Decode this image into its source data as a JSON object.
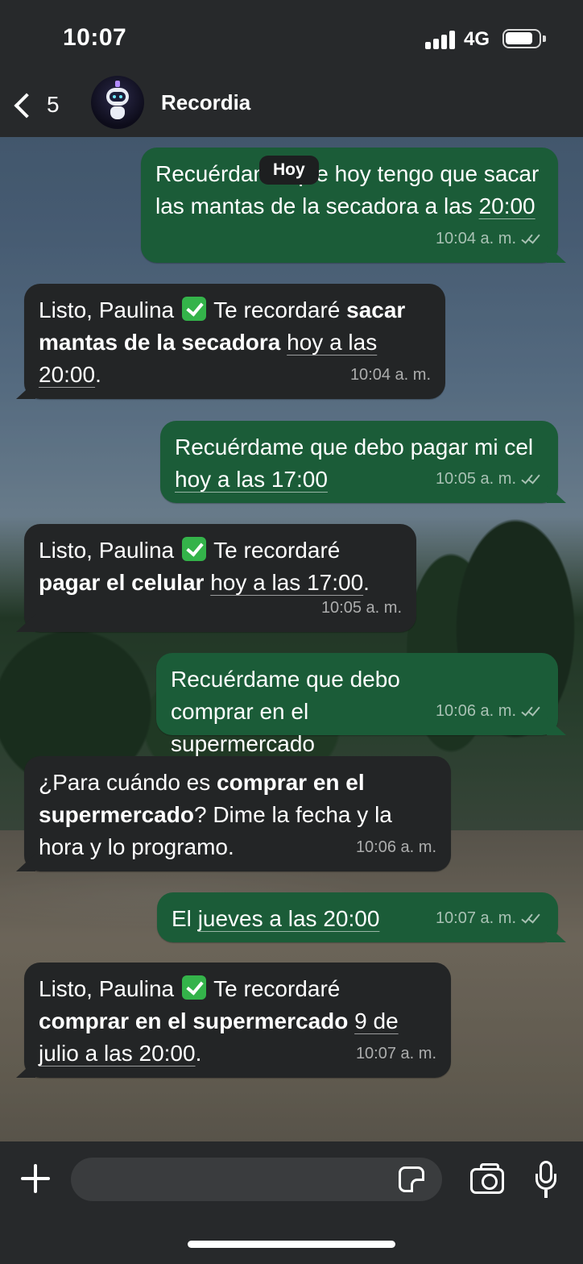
{
  "status_bar": {
    "time": "10:07",
    "network": "4G"
  },
  "header": {
    "back_count": "5",
    "contact_name": "Recordia"
  },
  "date_chip": "Hoy",
  "messages": [
    {
      "direction": "outgoing",
      "parts": [
        "Recuérdame que hoy tengo que sacar las mantas de la secadora a las ",
        "20:00"
      ],
      "time": "10:04 a. m."
    },
    {
      "direction": "incoming",
      "parts": [
        "Listo, Paulina ",
        " Te recordaré ",
        "sacar mantas de la secadora",
        " ",
        "hoy a las 20:00",
        "."
      ],
      "time": "10:04 a. m."
    },
    {
      "direction": "outgoing",
      "parts": [
        "Recuérdame que debo pagar mi cel ",
        "hoy a las 17:00"
      ],
      "time": "10:05 a. m."
    },
    {
      "direction": "incoming",
      "parts": [
        "Listo, Paulina ",
        " Te recordaré ",
        "pagar el celular",
        " ",
        "hoy a las 17:00",
        "."
      ],
      "time": "10:05 a. m."
    },
    {
      "direction": "outgoing",
      "parts": [
        "Recuérdame que debo comprar en el supermercado"
      ],
      "time": "10:06 a. m."
    },
    {
      "direction": "incoming",
      "parts": [
        "¿Para cuándo es ",
        "comprar en el supermercado",
        "? Dime la fecha y la hora y lo programo."
      ],
      "time": "10:06 a. m."
    },
    {
      "direction": "outgoing",
      "parts": [
        "El ",
        "jueves a las 20:00"
      ],
      "time": "10:07 a. m."
    },
    {
      "direction": "incoming",
      "parts": [
        "Listo, Paulina ",
        " Te recordaré ",
        "comprar en el supermercado",
        " ",
        "9 de julio a las 20:00",
        "."
      ],
      "time": "10:07 a. m."
    }
  ],
  "composer": {
    "placeholder": ""
  },
  "colors": {
    "outgoing_bubble": "#1b5c38",
    "incoming_bubble": "#232526",
    "bar_background": "#27292b"
  },
  "icons": [
    "back-chevron-icon",
    "robot-avatar",
    "check-emoji-icon",
    "double-check-icon",
    "plus-icon",
    "sticker-icon",
    "camera-icon",
    "mic-icon"
  ]
}
